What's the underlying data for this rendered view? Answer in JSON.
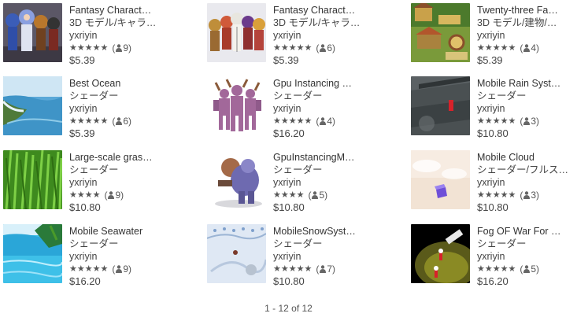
{
  "items": [
    {
      "title": "Fantasy Charact…",
      "category": "3D モデル/キャラ…",
      "publisher": "yxriyin",
      "stars": "★★★★★",
      "rating_count": "9",
      "price": "$5.39",
      "thumb": "chars-blue"
    },
    {
      "title": "Fantasy Charact…",
      "category": "3D モデル/キャラ…",
      "publisher": "yxriyin",
      "stars": "★★★★★",
      "rating_count": "6",
      "price": "$5.39",
      "thumb": "chars-skeleton"
    },
    {
      "title": "Twenty-three Fa…",
      "category": "3D モデル/建物/…",
      "publisher": "yxriyin",
      "stars": "★★★★★",
      "rating_count": "4",
      "price": "$5.39",
      "thumb": "buildings"
    },
    {
      "title": "Best Ocean",
      "category": "シェーダー",
      "publisher": "yxriyin",
      "stars": "★★★★★",
      "rating_count": "6",
      "price": "$5.39",
      "thumb": "ocean"
    },
    {
      "title": "Gpu Instancing …",
      "category": "シェーダー",
      "publisher": "yxriyin",
      "stars": "★★★★★",
      "rating_count": "4",
      "price": "$16.20",
      "thumb": "demons"
    },
    {
      "title": "Mobile Rain Syst…",
      "category": "シェーダー",
      "publisher": "yxriyin",
      "stars": "★★★★★",
      "rating_count": "3",
      "price": "$10.80",
      "thumb": "rain"
    },
    {
      "title": "Large-scale gras…",
      "category": "シェーダー",
      "publisher": "yxriyin",
      "stars": "★★★★",
      "rating_count": "9",
      "price": "$10.80",
      "thumb": "grass"
    },
    {
      "title": "GpuInstancingM…",
      "category": "シェーダー",
      "publisher": "yxriyin",
      "stars": "★★★★",
      "rating_count": "5",
      "price": "$10.80",
      "thumb": "ogre"
    },
    {
      "title": "Mobile Cloud",
      "category": "シェーダー/フルス…",
      "publisher": "yxriyin",
      "stars": "★★★★★",
      "rating_count": "3",
      "price": "$10.80",
      "thumb": "cloud"
    },
    {
      "title": "Mobile Seawater",
      "category": "シェーダー",
      "publisher": "yxriyin",
      "stars": "★★★★★",
      "rating_count": "9",
      "price": "$16.20",
      "thumb": "seawater"
    },
    {
      "title": "MobileSnowSyst…",
      "category": "シェーダー",
      "publisher": "yxriyin",
      "stars": "★★★★★",
      "rating_count": "7",
      "price": "$10.80",
      "thumb": "snow"
    },
    {
      "title": "Fog OF War For …",
      "category": "シェーダー",
      "publisher": "yxriyin",
      "stars": "★★★★★",
      "rating_count": "5",
      "price": "$16.20",
      "thumb": "fog"
    }
  ],
  "rating_icon": "person-icon",
  "pagination": {
    "text": "1 - 12 of 12"
  }
}
